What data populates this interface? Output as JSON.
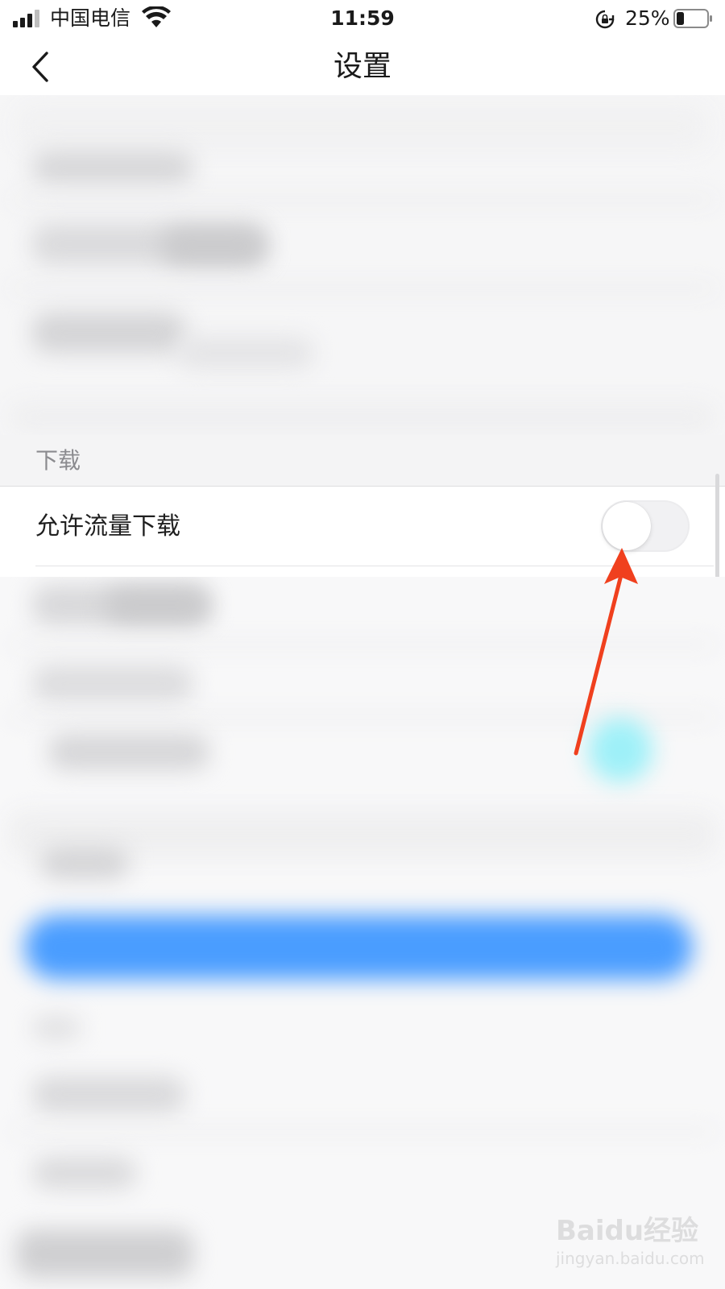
{
  "status_bar": {
    "carrier": "中国电信",
    "time": "11:59",
    "battery_percent": "25%",
    "battery_level": 0.25,
    "signal_bars": 4,
    "icons": [
      "signal-icon",
      "wifi-icon",
      "rotation-lock-icon",
      "battery-icon"
    ]
  },
  "nav": {
    "title": "设置",
    "back_icon": "chevron-left-icon"
  },
  "download_section": {
    "header": "下载",
    "rows": [
      {
        "label": "允许流量下载",
        "toggle_on": false
      }
    ]
  },
  "annotation": {
    "arrow_color": "#f0401e",
    "points_to": "toggle"
  },
  "watermark": {
    "logo": "Baidu经验",
    "url": "jingyan.baidu.com"
  },
  "colors": {
    "accent_blue": "#4a9dff",
    "background": "#f7f7f8"
  }
}
